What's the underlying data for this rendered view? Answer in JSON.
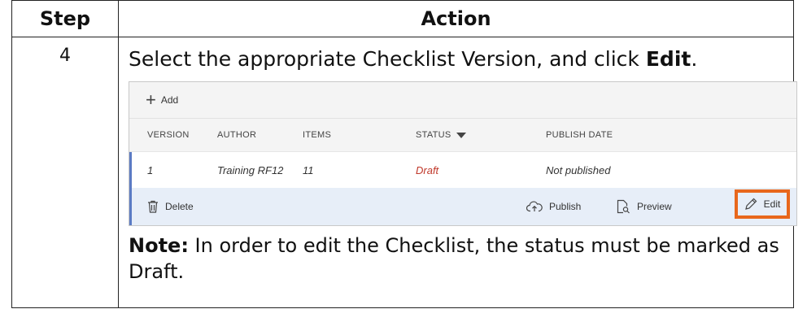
{
  "table": {
    "header_step": "Step",
    "header_action": "Action",
    "step_number": "4",
    "instruction_prefix": "Select the appropriate Checklist Version, and click ",
    "instruction_bold": "Edit",
    "instruction_suffix": ".",
    "note_label": "Note:",
    "note_text": " In order to edit the Checklist, the status must be marked as Draft."
  },
  "screenshot": {
    "toolbar": {
      "add_label": "Add"
    },
    "columns": [
      "VERSION",
      "AUTHOR",
      "ITEMS",
      "STATUS",
      "PUBLISH DATE"
    ],
    "row": {
      "version": "1",
      "author": "Training RF12",
      "items": "11",
      "status": "Draft",
      "publish_date": "Not published"
    },
    "actions": {
      "delete": "Delete",
      "publish": "Publish",
      "preview": "Preview",
      "edit": "Edit"
    },
    "colors": {
      "status_draft": "#c0392b",
      "highlight": "#e8671c",
      "selected_row_accent": "#5b7bc4",
      "action_bar_bg": "#e7eef8"
    }
  }
}
